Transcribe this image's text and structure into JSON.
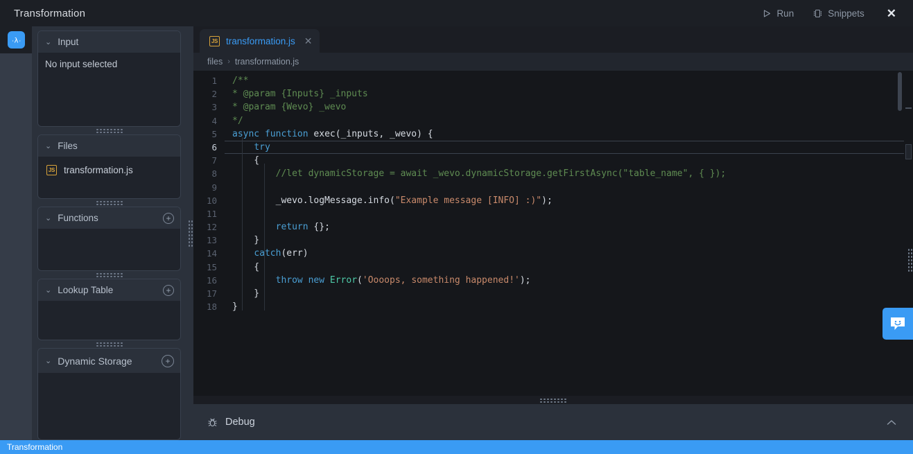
{
  "window": {
    "title": "Transformation",
    "run_label": "Run",
    "snippets_label": "Snippets",
    "close_label": "✕"
  },
  "rail": {
    "logo_label": "λ"
  },
  "sidebar": {
    "panels": [
      {
        "title": "Input",
        "empty_text": "No input selected",
        "has_add": false
      },
      {
        "title": "Files",
        "empty_text": "",
        "has_add": false,
        "files": [
          {
            "name": "transformation.js",
            "badge": "JS"
          }
        ]
      },
      {
        "title": "Functions",
        "empty_text": "",
        "has_add": true,
        "add_label": "+"
      },
      {
        "title": "Lookup Table",
        "empty_text": "",
        "has_add": true,
        "add_label": "+"
      },
      {
        "title": "Dynamic Storage",
        "empty_text": "",
        "has_add": true,
        "add_label": "+"
      }
    ]
  },
  "editor": {
    "tab": {
      "label": "transformation.js",
      "badge": "JS",
      "close": "✕"
    },
    "breadcrumb": {
      "root": "files",
      "separator": "›",
      "leaf": "transformation.js"
    },
    "active_line": 6,
    "line_numbers": [
      1,
      2,
      3,
      4,
      5,
      6,
      7,
      8,
      9,
      10,
      11,
      12,
      13,
      14,
      15,
      16,
      17,
      18
    ],
    "lines": [
      {
        "n": 1,
        "text": "/**"
      },
      {
        "n": 2,
        "text": "* @param {Inputs} _inputs"
      },
      {
        "n": 3,
        "text": "* @param {Wevo} _wevo"
      },
      {
        "n": 4,
        "text": "*/"
      },
      {
        "n": 5,
        "text": "async function exec(_inputs, _wevo) {"
      },
      {
        "n": 6,
        "text": "    try"
      },
      {
        "n": 7,
        "text": "    {"
      },
      {
        "n": 8,
        "text": "        //let dynamicStorage = await _wevo.dynamicStorage.getFirstAsync(\"table_name\", { });"
      },
      {
        "n": 9,
        "text": ""
      },
      {
        "n": 10,
        "text": "        _wevo.logMessage.info(\"Example message [INFO] :)\");"
      },
      {
        "n": 11,
        "text": ""
      },
      {
        "n": 12,
        "text": "        return {};"
      },
      {
        "n": 13,
        "text": "    }"
      },
      {
        "n": 14,
        "text": "    catch(err)"
      },
      {
        "n": 15,
        "text": "    {"
      },
      {
        "n": 16,
        "text": "        throw new Error('Oooops, something happened!');"
      },
      {
        "n": 17,
        "text": "    }"
      },
      {
        "n": 18,
        "text": "}"
      }
    ]
  },
  "debug": {
    "label": "Debug",
    "collapse_label": "⌃"
  },
  "status": {
    "label": "Transformation"
  },
  "colors": {
    "accent": "#3a9bf4",
    "titlebar_bg": "#1c1f25",
    "sidebar_bg": "#2b313b",
    "panel_bg": "#1f232b",
    "editor_bg": "#15171b",
    "comment": "#5f8c52",
    "keyword": "#4a9fd4",
    "string": "#c98a6b",
    "class": "#4ec9a7",
    "statusbar_bg": "#3a9bf4"
  }
}
